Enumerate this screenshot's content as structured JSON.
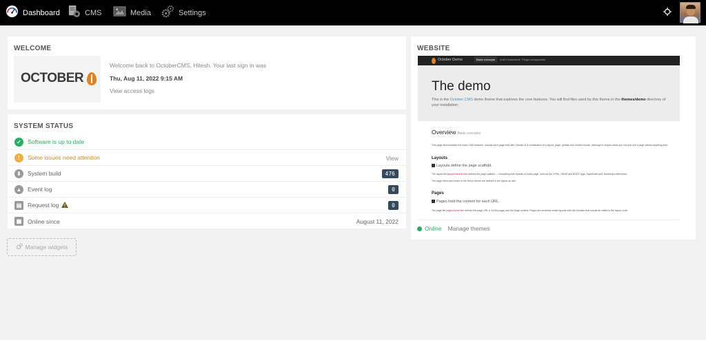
{
  "nav": {
    "items": [
      {
        "label": "Dashboard",
        "icon": "dashboard-gauge-icon"
      },
      {
        "label": "CMS",
        "icon": "cms-pages-icon"
      },
      {
        "label": "Media",
        "icon": "media-image-icon"
      },
      {
        "label": "Settings",
        "icon": "settings-gears-icon"
      }
    ],
    "preview_icon": "crosshair-icon"
  },
  "welcome": {
    "title": "WELCOME",
    "logo_text": "OCTOBER",
    "message": "Welcome back to OctoberCMS, Hitesh. Your last sign in was",
    "last_signin": "Thu, Aug 11, 2022 9:15 AM",
    "access_logs_link": "View access logs"
  },
  "system_status": {
    "title": "SYSTEM STATUS",
    "rows": [
      {
        "label": "Software is up to date",
        "icon": "check-circle-icon",
        "color": "#27ae60"
      },
      {
        "label": "Some issues need attention",
        "icon": "warning-circle-icon",
        "color": "#f0ad4e",
        "action": "View"
      },
      {
        "label": "System build",
        "icon": "build-icon",
        "color": "#999999",
        "value": "476"
      },
      {
        "label": "Event log",
        "icon": "event-log-icon",
        "color": "#999999",
        "value": "0"
      },
      {
        "label": "Request log",
        "icon": "request-log-icon",
        "color": "#999999",
        "value": "0"
      },
      {
        "label": "Online since",
        "icon": "calendar-icon",
        "color": "#999999",
        "value": "August 11, 2022"
      }
    ]
  },
  "manage_widgets_label": "Manage widgets",
  "website": {
    "title": "WEBSITE",
    "preview": {
      "brand": "October Demo",
      "tabs": [
        "Basic concepts",
        "AJAX framework",
        "Plugin components"
      ],
      "heading": "The demo",
      "lead_1": "This is the ",
      "lead_link": "October CMS",
      "lead_2": " demo theme that explores the core features. You will find files used by this theme in the ",
      "lead_bold": "themes/demo",
      "lead_3": " directory of your installation.",
      "overview": "Overview",
      "overview_sub": "Basic concepts",
      "overview_text": "This page demonstrates the basic CMS features. Usually each page built with October is a combination of a layout, page, partials and content blocks, although in simple cases you can just use a page without anything else.",
      "layouts_h": "Layouts",
      "layouts_sub": "Layouts define the page scaffold.",
      "layouts_text_1": "The layout file ",
      "layouts_code": "layouts/default.htm",
      "layouts_text_2": " defines the page scaffold — everything that repeats on each page, such as the HTML, HEAD and BODY tags, StyleSheet and JavaScript references.",
      "layouts_text_3": "The page menu and footer in the Demo theme are defined in the layout as well.",
      "pages_h": "Pages",
      "pages_sub": "Pages hold the content for each URL.",
      "pages_text_1": "The page file ",
      "pages_code": "pages/home.htm",
      "pages_text_2": " defines the page URL (/ for this page) and the page content. Pages are rendered inside layouts with this function that should be called in the layout code:"
    },
    "status": "Online",
    "manage_themes": "Manage themes"
  }
}
